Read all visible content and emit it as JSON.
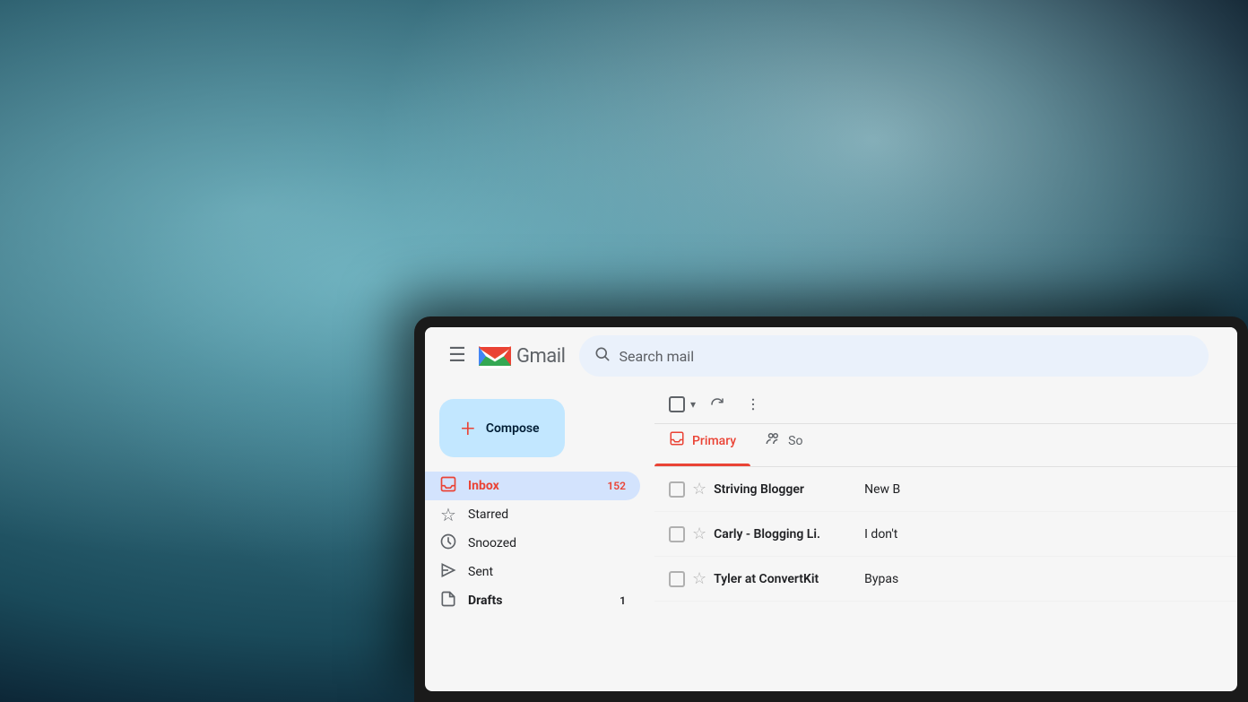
{
  "background": {
    "description": "Blurry ocean/water background in teal/blue tones"
  },
  "header": {
    "menu_label": "≡",
    "gmail_text": "Gmail",
    "search_placeholder": "Search mail"
  },
  "toolbar": {
    "select_all_label": "",
    "refresh_label": "↻",
    "more_label": "⋮"
  },
  "sidebar": {
    "compose_label": "Compose",
    "compose_icon": "+",
    "items": [
      {
        "id": "inbox",
        "label": "Inbox",
        "icon": "☐",
        "badge": "152",
        "active": true
      },
      {
        "id": "starred",
        "label": "Starred",
        "icon": "☆",
        "badge": "",
        "active": false
      },
      {
        "id": "snoozed",
        "label": "Snoozed",
        "icon": "🕐",
        "badge": "",
        "active": false
      },
      {
        "id": "sent",
        "label": "Sent",
        "icon": "➤",
        "badge": "",
        "active": false
      },
      {
        "id": "drafts",
        "label": "Drafts",
        "icon": "📄",
        "badge": "1",
        "active": false
      }
    ]
  },
  "tabs": [
    {
      "id": "primary",
      "label": "Primary",
      "icon": "☐",
      "active": true
    },
    {
      "id": "social",
      "label": "So",
      "icon": "👥",
      "active": false
    }
  ],
  "emails": [
    {
      "sender": "Striving Blogger",
      "subject": "New B",
      "preview": "",
      "starred": false
    },
    {
      "sender": "Carly - Blogging Li.",
      "subject": "I don't",
      "preview": "",
      "starred": false
    },
    {
      "sender": "Tyler at ConvertKit",
      "subject": "Bypas",
      "preview": "",
      "starred": false
    }
  ],
  "colors": {
    "accent_red": "#ea4335",
    "gmail_blue": "#4285f4",
    "gmail_red": "#ea4335",
    "gmail_yellow": "#fbbc05",
    "gmail_green": "#34a853",
    "sidebar_active_bg": "#d3e3fd",
    "compose_bg": "#c2e7ff",
    "search_bg": "#eaf1fb"
  }
}
